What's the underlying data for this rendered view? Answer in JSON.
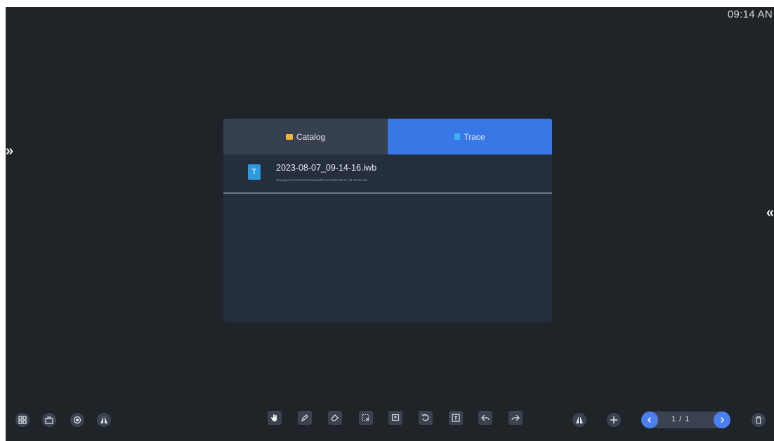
{
  "status_bar": {
    "time": "09:14 AN"
  },
  "dialog": {
    "tabs": [
      {
        "label": "Catalog",
        "icon": "folder-icon",
        "active": false
      },
      {
        "label": "Trace",
        "icon": "document-icon",
        "active": true
      }
    ],
    "file": {
      "name": "2023-08-07_09-14-16.iwb",
      "path": "/storage/emulated/0/Whiteboard/Trace/2023-08-07_09-14-16.iwb",
      "icon_letter": "T"
    }
  },
  "bottom_left_tools": [
    "apps-icon",
    "toolbox-icon",
    "eye-icon",
    "mirror-icon"
  ],
  "center_tools": [
    "hand-icon",
    "pen-icon",
    "eraser-icon",
    "select-icon",
    "insert-icon",
    "rotate-icon",
    "text-icon",
    "undo-icon",
    "redo-icon"
  ],
  "pager": {
    "label": "1 / 1"
  },
  "colors": {
    "board": "#1e2427",
    "tab_active": "#3777e6",
    "tab_inactive": "#37404e",
    "dialog": "#252e3d",
    "accent": "#4b7ff0"
  }
}
